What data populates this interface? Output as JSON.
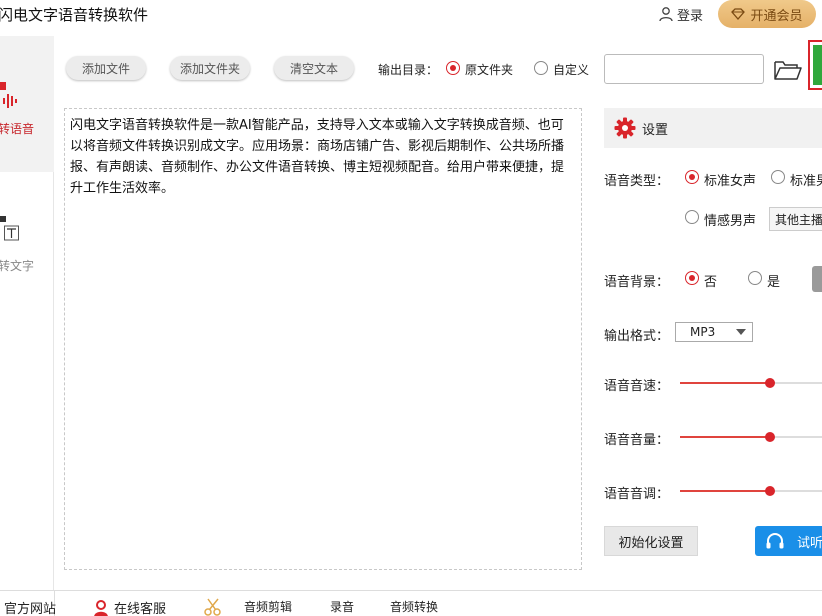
{
  "app": {
    "title": "闪电文字语音转换软件",
    "login_label": "登录",
    "vip_label": "开通会员"
  },
  "sidebar": {
    "items": [
      {
        "label": "转语音",
        "active": true,
        "icon": "text-to-speech-icon"
      },
      {
        "label": "转文字",
        "active": false,
        "icon": "speech-to-text-icon"
      }
    ]
  },
  "toolbar": {
    "add_file_label": "添加文件",
    "add_folder_label": "添加文件夹",
    "clear_text_label": "清空文本",
    "output_dir_label": "输出目录：",
    "output_options": [
      {
        "label": "原文件夹",
        "selected": true
      },
      {
        "label": "自定义",
        "selected": false
      }
    ],
    "output_path_value": ""
  },
  "editor": {
    "text": "闪电文字语音转换软件是一款AI智能产品，支持导入文本或输入文字转换成音频、也可以将音频文件转换识别成文字。应用场景：商场店铺广告、影视后期制作、公共场所播报、有声朗读、音频制作、办公文件语音转换、博主短视频配音。给用户带来便捷，提升工作生活效率。"
  },
  "settings": {
    "header": "设置",
    "voice_type_label": "语音类型：",
    "voice_options": [
      {
        "label": "标准女声",
        "selected": true
      },
      {
        "label": "标准男",
        "selected": false
      },
      {
        "label": "情感男声",
        "selected": false
      }
    ],
    "other_anchor_label": "其他主播",
    "background_label": "语音背景：",
    "background_options": [
      {
        "label": "否",
        "selected": true
      },
      {
        "label": "是",
        "selected": false
      }
    ],
    "format_label": "输出格式：",
    "format_value": "MP3",
    "speed_label": "语音音速：",
    "speed_value": 0.5,
    "volume_label": "语音音量：",
    "volume_value": 0.5,
    "pitch_label": "语音音调：",
    "pitch_value": 0.5,
    "reset_label": "初始化设置",
    "listen_label": "试听"
  },
  "bottom_bar": {
    "website_label": "官方网站",
    "service_label": "在线客服",
    "audio_edit_label": "音频剪辑",
    "record_label": "录音",
    "audio_convert_label": "音频转换"
  },
  "colors": {
    "accent_red": "#d9252b",
    "start_green": "#2fa83c",
    "listen_blue": "#1a8fe8",
    "vip_gold": "#e5b168"
  }
}
